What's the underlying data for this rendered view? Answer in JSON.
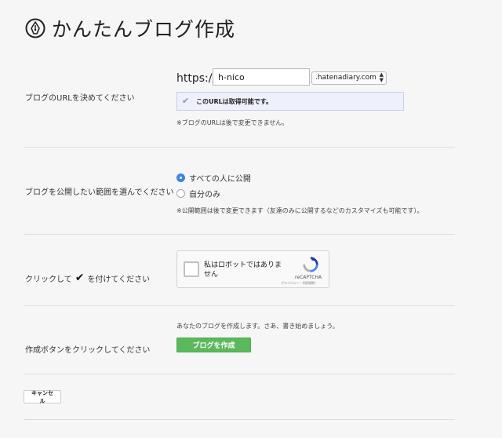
{
  "page": {
    "title": "かんたんブログ作成"
  },
  "url_section": {
    "label": "ブログのURLを決めてください",
    "protocol": "https://",
    "subdomain_value": "h-nico",
    "domain_selected": ".hatenadiary.com",
    "availability": "このURLは取得可能です。",
    "note": "※ブログのURLは後で変更できません。"
  },
  "visibility_section": {
    "label": "ブログを公開したい範囲を選んでください",
    "options": [
      {
        "label": "すべての人に公開",
        "selected": true
      },
      {
        "label": "自分のみ",
        "selected": false
      }
    ],
    "note": "※公開範囲は後で変更できます（友達のみに公開するなどのカスタマイズも可能です）。"
  },
  "captcha_section": {
    "label_before": "クリックして",
    "check_glyph": "✔",
    "label_after": "を付けてください",
    "captcha_text": "私はロボットではありません",
    "recaptcha_name": "reCAPTCHA",
    "recaptcha_links": "プライバシー - 利用規約"
  },
  "create_section": {
    "label": "作成ボタンをクリックしてください",
    "message": "あなたのブログを作成します。さあ、書き始めましょう。",
    "button_label": "ブログを作成"
  },
  "footer": {
    "cancel_label": "キャンセル"
  },
  "colors": {
    "primary_button": "#5cb85c",
    "radio_selected": "#3a86e0",
    "availability_bg": "#eef0fb"
  },
  "icons": {
    "logo": "fountain-pen-nib-icon",
    "check": "check-icon",
    "captcha": "recaptcha-icon"
  }
}
